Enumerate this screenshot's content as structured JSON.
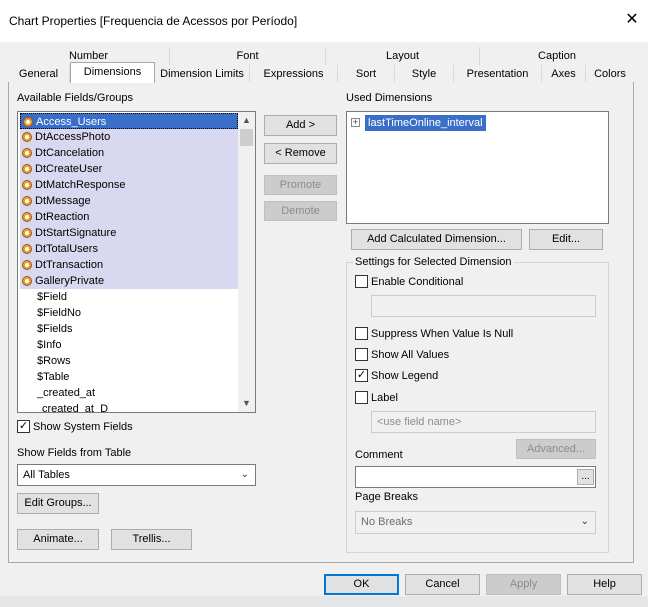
{
  "window": {
    "title": "Chart Properties [Frequencia de Acessos por Período]",
    "close_glyph": "✕"
  },
  "tabs_back": [
    "Number",
    "Font",
    "Layout",
    "Caption"
  ],
  "tabs_front": [
    "General",
    "Dimensions",
    "Dimension Limits",
    "Expressions",
    "Sort",
    "Style",
    "Presentation",
    "Axes",
    "Colors"
  ],
  "active_tab": "Dimensions",
  "available": {
    "label": "Available Fields/Groups",
    "items": [
      "Access_Users",
      "DtAccessPhoto",
      "DtCancelation",
      "DtCreateUser",
      "DtMatchResponse",
      "DtMessage",
      "DtReaction",
      "DtStartSignature",
      "DtTotalUsers",
      "DtTransaction",
      "GalleryPrivate",
      "$Field",
      "$FieldNo",
      "$Fields",
      "$Info",
      "$Rows",
      "$Table",
      "_created_at",
      "created_at_D"
    ],
    "scroll_up": "▲",
    "scroll_down": "▼"
  },
  "buttons": {
    "add": "Add >",
    "remove": "< Remove",
    "promote": "Promote",
    "demote": "Demote",
    "add_calc": "Add Calculated Dimension...",
    "edit": "Edit...",
    "advanced": "Advanced...",
    "ellipsis": "...",
    "edit_groups": "Edit Groups...",
    "animate": "Animate...",
    "trellis": "Trellis...",
    "ok": "OK",
    "cancel": "Cancel",
    "apply": "Apply",
    "help": "Help"
  },
  "used": {
    "label": "Used Dimensions",
    "items": [
      "lastTimeOnline_interval"
    ],
    "expander": "+"
  },
  "show_system_fields": {
    "label": "Show System Fields",
    "checked": true
  },
  "show_fields_from": {
    "label": "Show Fields from Table",
    "value": "All Tables"
  },
  "settings": {
    "legend": "Settings for Selected Dimension",
    "enable_conditional": "Enable Conditional",
    "suppress_null": "Suppress When Value Is Null",
    "show_all_values": "Show All Values",
    "show_legend": "Show Legend",
    "label": "Label",
    "label_placeholder": "<use field name>",
    "comment": "Comment",
    "page_breaks": "Page Breaks",
    "page_breaks_value": "No Breaks",
    "check_mark": "✓"
  },
  "icons": [
    "field-icon",
    "close-icon",
    "chevron-down-icon",
    "expander-icon",
    "scroll-up-icon",
    "scroll-down-icon"
  ]
}
